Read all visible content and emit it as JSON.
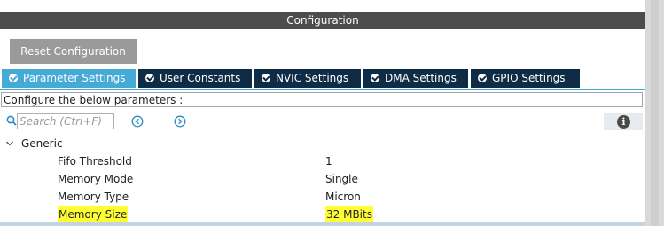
{
  "header": {
    "title": "Configuration"
  },
  "toolbar": {
    "reset_label": "Reset Configuration"
  },
  "tabs": [
    {
      "label": "Parameter Settings",
      "active": true
    },
    {
      "label": "User Constants",
      "active": false
    },
    {
      "label": "NVIC Settings",
      "active": false
    },
    {
      "label": "DMA Settings",
      "active": false
    },
    {
      "label": "GPIO Settings",
      "active": false
    }
  ],
  "config_hint": "Configure the below parameters :",
  "search": {
    "placeholder": "Search (Ctrl+F)",
    "value": ""
  },
  "icons": {
    "search": "search-icon",
    "prev": "previous-arrow-icon",
    "next": "next-arrow-icon",
    "info": "info-icon",
    "collapse": "chevron-down-icon",
    "check": "check-circle-icon"
  },
  "info_glyph": "i",
  "tree": {
    "group": "Generic",
    "params": [
      {
        "name": "Fifo Threshold",
        "value": "1",
        "highlighted": false
      },
      {
        "name": "Memory Mode",
        "value": "Single",
        "highlighted": false
      },
      {
        "name": "Memory Type",
        "value": "Micron",
        "highlighted": false
      },
      {
        "name": "Memory Size",
        "value": "32 MBits",
        "highlighted": true
      }
    ]
  },
  "colors": {
    "title_bar": "#4d4d4d",
    "tab_active": "#45aad6",
    "tab_inactive": "#0f2c47",
    "reset_button": "#9a9a9a",
    "highlight": "#ffff33",
    "nav_icon": "#2b8cc4"
  }
}
